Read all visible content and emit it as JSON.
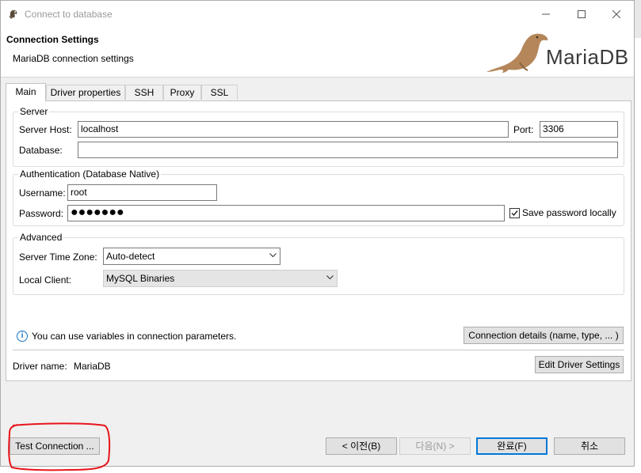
{
  "window": {
    "title": "Connect to database"
  },
  "header": {
    "title": "Connection Settings",
    "subtitle": "MariaDB connection settings",
    "logo_text": "MariaDB"
  },
  "tabs": [
    {
      "label": "Main",
      "active": true
    },
    {
      "label": "Driver properties",
      "active": false
    },
    {
      "label": "SSH",
      "active": false
    },
    {
      "label": "Proxy",
      "active": false
    },
    {
      "label": "SSL",
      "active": false
    }
  ],
  "server": {
    "group_label": "Server",
    "host_label": "Server Host:",
    "host_value": "localhost",
    "port_label": "Port:",
    "port_value": "3306",
    "database_label": "Database:",
    "database_value": ""
  },
  "auth": {
    "group_label": "Authentication (Database Native)",
    "username_label": "Username:",
    "username_value": "root",
    "password_label": "Password:",
    "password_value": "●●●●●●●",
    "save_password_label": "Save password locally",
    "save_password_checked": true
  },
  "advanced": {
    "group_label": "Advanced",
    "timezone_label": "Server Time Zone:",
    "timezone_value": "Auto-detect",
    "client_label": "Local Client:",
    "client_value": "MySQL Binaries"
  },
  "info": {
    "text": "You can use variables in connection parameters.",
    "details_button": "Connection details (name, type, ... )"
  },
  "driver": {
    "label": "Driver name:",
    "value": "MariaDB",
    "edit_button": "Edit Driver Settings"
  },
  "footer": {
    "test_button": "Test Connection ...",
    "back_button": "< 이전(B)",
    "next_button": "다음(N) >",
    "finish_button": "완료(F)",
    "cancel_button": "취소"
  },
  "colors": {
    "accent": "#0078d7",
    "annotation": "#e8141b",
    "logo_seal": "#b4865a"
  }
}
